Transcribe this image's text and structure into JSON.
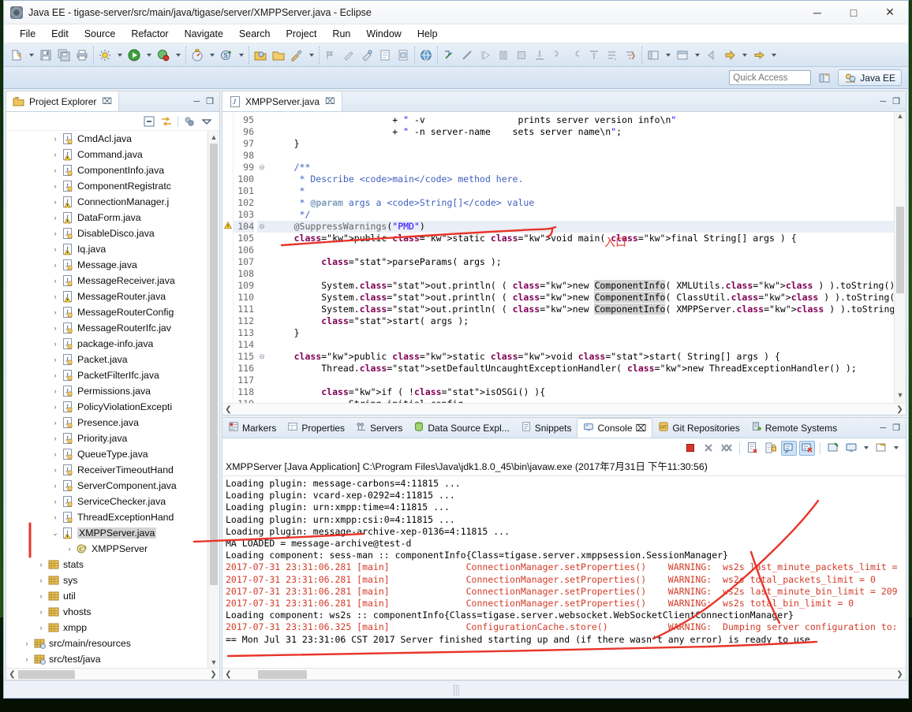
{
  "window": {
    "title": "Java EE - tigase-server/src/main/java/tigase/server/XMPPServer.java - Eclipse",
    "minimize": "─",
    "maximize": "□",
    "close": "✕"
  },
  "menubar": [
    "File",
    "Edit",
    "Source",
    "Refactor",
    "Navigate",
    "Search",
    "Project",
    "Run",
    "Window",
    "Help"
  ],
  "toolbar": {
    "quick_access_placeholder": "Quick Access",
    "perspective_label": "Java EE"
  },
  "project_explorer": {
    "tab_label": "Project Explorer",
    "close_glyph": "⌧",
    "minimize_glyph": "─",
    "maximize_glyph": "❐",
    "items": [
      {
        "label": "CmdAcl.java",
        "indent": 3,
        "arrow": "›",
        "icon": "java-file",
        "selected": false
      },
      {
        "label": "Command.java",
        "indent": 3,
        "arrow": "›",
        "icon": "java-file-warn",
        "selected": false
      },
      {
        "label": "ComponentInfo.java",
        "indent": 3,
        "arrow": "›",
        "icon": "java-file",
        "selected": false
      },
      {
        "label": "ComponentRegistratc",
        "indent": 3,
        "arrow": "›",
        "icon": "java-file",
        "selected": false
      },
      {
        "label": "ConnectionManager.j",
        "indent": 3,
        "arrow": "›",
        "icon": "java-file-warn",
        "selected": false
      },
      {
        "label": "DataForm.java",
        "indent": 3,
        "arrow": "›",
        "icon": "java-file-warn",
        "selected": false
      },
      {
        "label": "DisableDisco.java",
        "indent": 3,
        "arrow": "›",
        "icon": "java-file",
        "selected": false
      },
      {
        "label": "Iq.java",
        "indent": 3,
        "arrow": "›",
        "icon": "java-file-warn",
        "selected": false
      },
      {
        "label": "Message.java",
        "indent": 3,
        "arrow": "›",
        "icon": "java-file",
        "selected": false
      },
      {
        "label": "MessageReceiver.java",
        "indent": 3,
        "arrow": "›",
        "icon": "java-file",
        "selected": false
      },
      {
        "label": "MessageRouter.java",
        "indent": 3,
        "arrow": "›",
        "icon": "java-file-warn",
        "selected": false
      },
      {
        "label": "MessageRouterConfig",
        "indent": 3,
        "arrow": "›",
        "icon": "java-file",
        "selected": false
      },
      {
        "label": "MessageRouterIfc.jav",
        "indent": 3,
        "arrow": "›",
        "icon": "java-file",
        "selected": false
      },
      {
        "label": "package-info.java",
        "indent": 3,
        "arrow": "›",
        "icon": "java-file",
        "selected": false
      },
      {
        "label": "Packet.java",
        "indent": 3,
        "arrow": "›",
        "icon": "java-file",
        "selected": false
      },
      {
        "label": "PacketFilterIfc.java",
        "indent": 3,
        "arrow": "›",
        "icon": "java-file",
        "selected": false
      },
      {
        "label": "Permissions.java",
        "indent": 3,
        "arrow": "›",
        "icon": "java-file",
        "selected": false
      },
      {
        "label": "PolicyViolationExcepti",
        "indent": 3,
        "arrow": "›",
        "icon": "java-file",
        "selected": false
      },
      {
        "label": "Presence.java",
        "indent": 3,
        "arrow": "›",
        "icon": "java-file",
        "selected": false
      },
      {
        "label": "Priority.java",
        "indent": 3,
        "arrow": "›",
        "icon": "java-file",
        "selected": false
      },
      {
        "label": "QueueType.java",
        "indent": 3,
        "arrow": "›",
        "icon": "java-file",
        "selected": false
      },
      {
        "label": "ReceiverTimeoutHand",
        "indent": 3,
        "arrow": "›",
        "icon": "java-file",
        "selected": false
      },
      {
        "label": "ServerComponent.java",
        "indent": 3,
        "arrow": "›",
        "icon": "java-file",
        "selected": false
      },
      {
        "label": "ServiceChecker.java",
        "indent": 3,
        "arrow": "›",
        "icon": "java-file",
        "selected": false
      },
      {
        "label": "ThreadExceptionHand",
        "indent": 3,
        "arrow": "›",
        "icon": "java-file",
        "selected": false
      },
      {
        "label": "XMPPServer.java",
        "indent": 3,
        "arrow": "⌄",
        "icon": "java-file-warn",
        "selected": true
      },
      {
        "label": "XMPPServer",
        "indent": 4,
        "arrow": "›",
        "icon": "java-class",
        "selected": false
      },
      {
        "label": "stats",
        "indent": 2,
        "arrow": "›",
        "icon": "package",
        "selected": false
      },
      {
        "label": "sys",
        "indent": 2,
        "arrow": "›",
        "icon": "package",
        "selected": false
      },
      {
        "label": "util",
        "indent": 2,
        "arrow": "›",
        "icon": "package",
        "selected": false
      },
      {
        "label": "vhosts",
        "indent": 2,
        "arrow": "›",
        "icon": "package",
        "selected": false
      },
      {
        "label": "xmpp",
        "indent": 2,
        "arrow": "›",
        "icon": "package",
        "selected": false
      },
      {
        "label": "src/main/resources",
        "indent": 1,
        "arrow": "›",
        "icon": "source-folder",
        "selected": false
      },
      {
        "label": "src/test/java",
        "indent": 1,
        "arrow": "›",
        "icon": "source-folder",
        "selected": false
      }
    ]
  },
  "editor": {
    "tab_label": "XMPPServer.java",
    "close_glyph": "⌧",
    "minimize_glyph": "─",
    "maximize_glyph": "❐",
    "first_line": 95,
    "lines": [
      {
        "n": 95,
        "fold": "",
        "text": "                       + \" -v                 prints server version info\\n\"",
        "kind": "string-tail"
      },
      {
        "n": 96,
        "fold": "",
        "text": "                       + \" -n server-name    sets server name\\n\";",
        "kind": "string-tail"
      },
      {
        "n": 97,
        "fold": "",
        "text": "     }",
        "kind": "code"
      },
      {
        "n": 98,
        "fold": "",
        "text": "",
        "kind": "code"
      },
      {
        "n": 99,
        "fold": "⊖",
        "text": "     /**",
        "kind": "javadoc"
      },
      {
        "n": 100,
        "fold": "",
        "text": "      * Describe <code>main</code> method here.",
        "kind": "javadoc"
      },
      {
        "n": 101,
        "fold": "",
        "text": "      *",
        "kind": "javadoc"
      },
      {
        "n": 102,
        "fold": "",
        "text": "      * @param args a <code>String[]</code> value",
        "kind": "javadoc"
      },
      {
        "n": 103,
        "fold": "",
        "text": "      */",
        "kind": "javadoc"
      },
      {
        "n": 104,
        "fold": "⊖",
        "text": "     @SuppressWarnings(\"PMD\")",
        "kind": "annotation"
      },
      {
        "n": 105,
        "fold": "",
        "text": "     public static void main( final String[] args ) {",
        "kind": "declaration"
      },
      {
        "n": 106,
        "fold": "",
        "text": "",
        "kind": "code"
      },
      {
        "n": 107,
        "fold": "",
        "text": "          parseParams( args );",
        "kind": "code"
      },
      {
        "n": 108,
        "fold": "",
        "text": "",
        "kind": "code"
      },
      {
        "n": 109,
        "fold": "",
        "text": "          System.out.println( ( new ComponentInfo( XMLUtils.class ) ).toString() );",
        "kind": "code"
      },
      {
        "n": 110,
        "fold": "",
        "text": "          System.out.println( ( new ComponentInfo( ClassUtil.class ) ).toString() );",
        "kind": "code"
      },
      {
        "n": 111,
        "fold": "",
        "text": "          System.out.println( ( new ComponentInfo( XMPPServer.class ) ).toString() );",
        "kind": "code"
      },
      {
        "n": 112,
        "fold": "",
        "text": "          start( args );",
        "kind": "code"
      },
      {
        "n": 113,
        "fold": "",
        "text": "     }",
        "kind": "code"
      },
      {
        "n": 114,
        "fold": "",
        "text": "",
        "kind": "code"
      },
      {
        "n": 115,
        "fold": "⊖",
        "text": "     public static void start( String[] args ) {",
        "kind": "declaration"
      },
      {
        "n": 116,
        "fold": "",
        "text": "          Thread.setDefaultUncaughtExceptionHandler( new ThreadExceptionHandler() );",
        "kind": "code"
      },
      {
        "n": 117,
        "fold": "",
        "text": "",
        "kind": "code"
      },
      {
        "n": 118,
        "fold": "",
        "text": "          if ( !isOSGi() ){",
        "kind": "code"
      },
      {
        "n": 119,
        "fold": "",
        "text": "               String initial_config",
        "kind": "code"
      }
    ]
  },
  "bottom_panel": {
    "tabs": [
      {
        "label": "Markers",
        "icon": "markers-icon",
        "active": false
      },
      {
        "label": "Properties",
        "icon": "properties-icon",
        "active": false
      },
      {
        "label": "Servers",
        "icon": "servers-icon",
        "active": false
      },
      {
        "label": "Data Source Expl...",
        "icon": "data-source-icon",
        "active": false
      },
      {
        "label": "Snippets",
        "icon": "snippets-icon",
        "active": false
      },
      {
        "label": "Console",
        "icon": "console-icon",
        "active": true,
        "close_glyph": "⌧"
      },
      {
        "label": "Git Repositories",
        "icon": "git-icon",
        "active": false
      },
      {
        "label": "Remote Systems",
        "icon": "remote-systems-icon",
        "active": false
      }
    ],
    "minimize_glyph": "─",
    "maximize_glyph": "❐",
    "toolbar_buttons": [
      {
        "name": "terminate-button",
        "glyph": "stop"
      },
      {
        "name": "remove-launch-button",
        "glyph": "x"
      },
      {
        "name": "remove-all-terminated-button",
        "glyph": "xx"
      },
      {
        "name": "clear-console-button",
        "glyph": "clear"
      },
      {
        "name": "scroll-lock-button",
        "glyph": "lock"
      },
      {
        "name": "show-console-on-stdout-button",
        "glyph": "stdout",
        "active": true
      },
      {
        "name": "show-console-on-stderr-button",
        "glyph": "stderr",
        "active": true
      },
      {
        "name": "pin-console-button",
        "glyph": "pin"
      },
      {
        "name": "display-selected-console-button",
        "glyph": "monitor"
      },
      {
        "name": "open-console-button",
        "glyph": "new"
      }
    ]
  },
  "console": {
    "header": "XMPPServer [Java Application] C:\\Program Files\\Java\\jdk1.8.0_45\\bin\\javaw.exe (2017年7月31日 下午11:30:56)",
    "lines": [
      {
        "t": "Loading plugin: message-carbons=4:11815 ...",
        "err": false
      },
      {
        "t": "Loading plugin: vcard-xep-0292=4:11815 ...",
        "err": false
      },
      {
        "t": "Loading plugin: urn:xmpp:time=4:11815 ...",
        "err": false
      },
      {
        "t": "Loading plugin: urn:xmpp:csi:0=4:11815 ...",
        "err": false
      },
      {
        "t": "Loading plugin: message-archive-xep-0136=4:11815 ...",
        "err": false
      },
      {
        "t": "MA LOADED = message-archive@test-d",
        "err": false
      },
      {
        "t": "Loading component: sess-man :: componentInfo{Class=tigase.server.xmppsession.SessionManager}",
        "err": false
      },
      {
        "t": "2017-07-31 23:31:06.281 [main]              ConnectionManager.setProperties()    WARNING:  ws2s last_minute_packets_limit =",
        "err": true
      },
      {
        "t": "2017-07-31 23:31:06.281 [main]              ConnectionManager.setProperties()    WARNING:  ws2s total_packets_limit = 0",
        "err": true
      },
      {
        "t": "2017-07-31 23:31:06.281 [main]              ConnectionManager.setProperties()    WARNING:  ws2s last_minute_bin_limit = 209",
        "err": true
      },
      {
        "t": "2017-07-31 23:31:06.281 [main]              ConnectionManager.setProperties()    WARNING:  ws2s total_bin_limit = 0",
        "err": true
      },
      {
        "t": "Loading component: ws2s :: componentInfo{Class=tigase.server.websocket.WebSocketClientConnectionManager}",
        "err": false
      },
      {
        "t": "2017-07-31 23:31:06.325 [main]              ConfigurationCache.store()           WARNING:  Dumping server configuration to:",
        "err": true
      },
      {
        "t": "== Mon Jul 31 23:31:06 CST 2017 Server finished starting up and (if there wasn't any error) is ready to use",
        "err": false
      }
    ]
  },
  "annotations": {
    "entry_point_label": "入口",
    "pen_color": "#e8352a"
  }
}
